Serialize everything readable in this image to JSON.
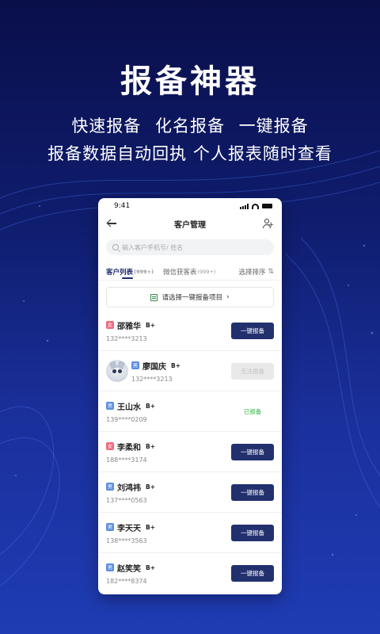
{
  "promo": {
    "headline": "报备神器",
    "line1": "快速报备   化名报备   一键报备",
    "line2": "报备数据自动回执    个人报表随时查看"
  },
  "status_bar": {
    "time": "9:41"
  },
  "nav": {
    "title": "客户管理"
  },
  "search": {
    "placeholder": "输入客户手机号/ 姓名"
  },
  "tabs": [
    {
      "label": "客户列表",
      "count": "(999+)"
    },
    {
      "label": "微信获客表",
      "count": "(999+)"
    },
    {
      "label": "选择排序"
    }
  ],
  "select_bar": {
    "label": "请选择一键报备项目",
    "chevron": "›"
  },
  "customers": [
    {
      "gender": "女",
      "name": "邵雅华",
      "grade": "B+",
      "phone": "132****3213",
      "action": "一键报备"
    },
    {
      "gender": "男",
      "name": "廖国庆",
      "grade": "B+",
      "phone": "132****3213",
      "action": "无法报备"
    },
    {
      "gender": "男",
      "name": "王山水",
      "grade": "B+",
      "phone": "139****0209",
      "action": "已报备"
    },
    {
      "gender": "女",
      "name": "李柔和",
      "grade": "B+",
      "phone": "188****3174",
      "action": "一键报备"
    },
    {
      "gender": "男",
      "name": "刘鸿祎",
      "grade": "B+",
      "phone": "137****0563",
      "action": "一键报备"
    },
    {
      "gender": "男",
      "name": "李天天",
      "grade": "B+",
      "phone": "138****3563",
      "action": "一键报备"
    },
    {
      "gender": "男",
      "name": "赵笑笑",
      "grade": "B+",
      "phone": "182****8374",
      "action": "一键报备"
    }
  ],
  "colors": {
    "background_top": "#0a0f4a",
    "background_bottom": "#1f3cb4",
    "primary_button": "#22306e",
    "done_green": "#3bb54a",
    "female_badge": "#f06a7d",
    "male_badge": "#5a8de0"
  }
}
